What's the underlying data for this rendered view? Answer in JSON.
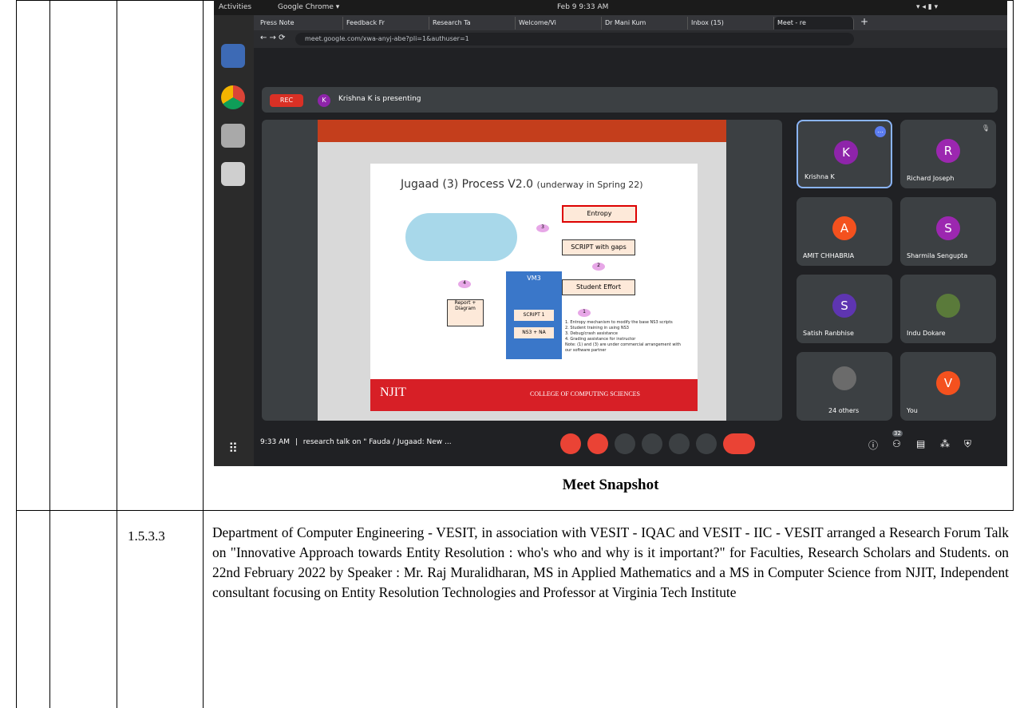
{
  "gnome": {
    "activities": "Activities",
    "app_menu": "Google Chrome ▾",
    "clock": "Feb 9  9:33 AM"
  },
  "browser": {
    "tabs": [
      {
        "label": "Press Note"
      },
      {
        "label": "Feedback Fr"
      },
      {
        "label": "Research Ta"
      },
      {
        "label": "Welcome/Vi"
      },
      {
        "label": "Dr Mani Kum"
      },
      {
        "label": "Inbox (15)"
      },
      {
        "label": "Meet - re"
      }
    ],
    "url": "meet.google.com/xwa-anyj-abe?pli=1&authuser=1"
  },
  "meet": {
    "rec_label": "REC",
    "presenter_initial": "K",
    "presenting_text": "Krishna K is presenting",
    "slide": {
      "title": "Jugaad (3) Process V2.0",
      "title_note": "(underway in Spring 22)",
      "entropy": "Entropy",
      "script_gaps": "SCRIPT with gaps",
      "student_effort": "Student Effort",
      "vm": "VM3",
      "report": "Report + Diagram",
      "script1": "SCRIPT 1",
      "ns3": "NS3 + NA",
      "n1": "1",
      "n2": "2",
      "n3": "3",
      "n4": "4",
      "notes": [
        "1. Entropy mechanism to modify the base NS3 scripts",
        "2. Student training in using NS3",
        "3. Debug/crash assistance",
        "4. Grading assistance for instructor",
        "Note: (1) and (3) are under commercial arrangement with our software partner"
      ],
      "footer_logo": "NJIT",
      "footer_text": "COLLEGE OF COMPUTING SCIENCES"
    },
    "participants": [
      {
        "initial": "K",
        "name": "Krishna K",
        "color": "#8e24aa"
      },
      {
        "initial": "R",
        "name": "Richard Joseph",
        "color": "#9c27b0"
      },
      {
        "initial": "A",
        "name": "AMIT CHHABRIA",
        "color": "#f4511e"
      },
      {
        "initial": "S",
        "name": "Sharmila Sengupta",
        "color": "#9c27b0"
      },
      {
        "initial": "S",
        "name": "Satish Ranbhise",
        "color": "#5e35b1"
      },
      {
        "initial": "",
        "name": "Indu Dokare",
        "color": "#5a7a3a"
      },
      {
        "initial": "",
        "name": "24 others",
        "color": "#6b6b6b"
      },
      {
        "initial": "V",
        "name": "You",
        "color": "#f4511e"
      }
    ],
    "bottom": {
      "time": "9:33 AM",
      "separator": "|",
      "meeting_title": "research talk on \" Fauda / Jugaad: New ...",
      "people_count": "32"
    }
  },
  "document": {
    "caption": "Meet Snapshot",
    "row_number": "1.5.3.3",
    "paragraph": "Department of Computer Engineering - VESIT, in association with VESIT - IQAC and VESIT - IIC - VESIT arranged a Research Forum Talk on \"Innovative Approach towards Entity Resolution : who's who and why is it important?\" for Faculties, Research Scholars and Students. on 22nd February 2022 by  Speaker : Mr. Raj Muralidharan, MS in Applied Mathematics and a MS in Computer Science from NJIT, Independent consultant focusing on Entity Resolution Technologies and Professor at Virginia Tech Institute"
  }
}
